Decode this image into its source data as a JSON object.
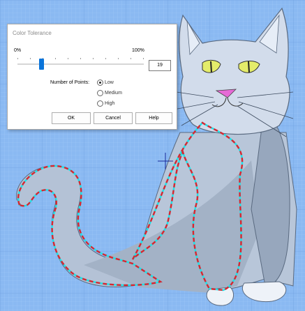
{
  "dialog": {
    "title": "Color Tolerance",
    "slider": {
      "min_label": "0%",
      "max_label": "100%",
      "value": 19
    },
    "value_text": "19",
    "points_label": "Number of Points:",
    "options": [
      {
        "label": "Low",
        "selected": true
      },
      {
        "label": "Medium",
        "selected": false
      },
      {
        "label": "High",
        "selected": false
      }
    ],
    "buttons": {
      "ok": "OK",
      "cancel": "Cancel",
      "help": "Help"
    }
  },
  "colors": {
    "background": "#8ab9f2",
    "grid_minor": "#a2c9f6",
    "grid_major": "#6e9fe0",
    "selection_red": "#d9262f",
    "selection_cyan": "#20e0e6",
    "accent": "#0a74da"
  }
}
